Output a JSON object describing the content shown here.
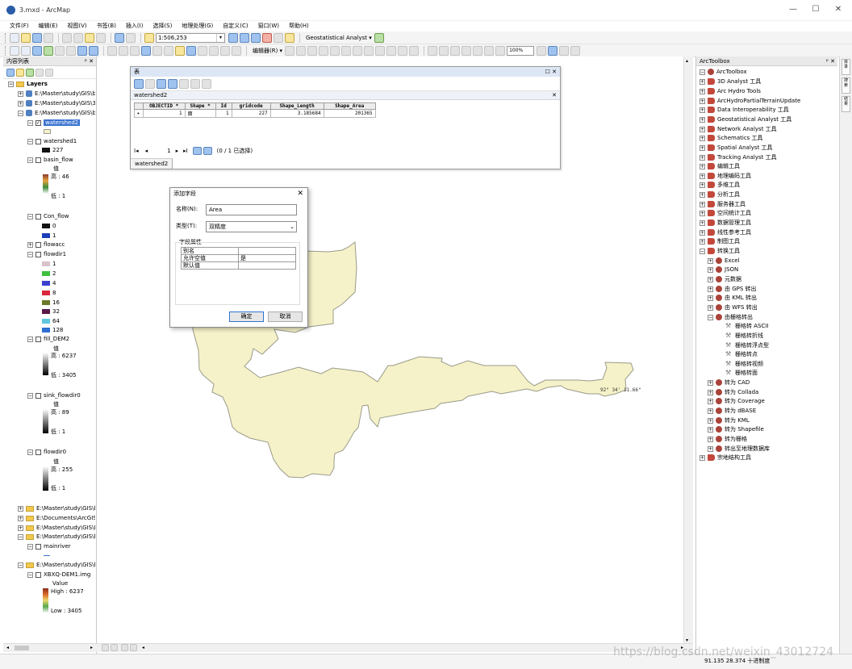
{
  "window": {
    "title": "3.mxd - ArcMap",
    "min": "—",
    "max": "☐",
    "close": "✕"
  },
  "menu": [
    "文件(F)",
    "编辑(E)",
    "视图(V)",
    "书签(B)",
    "插入(I)",
    "选择(S)",
    "地理处理(G)",
    "自定义(C)",
    "窗口(W)",
    "帮助(H)"
  ],
  "toolbar": {
    "scale": "1:506,253",
    "geostat": "Geostatistical Analyst ▾",
    "editor": "编辑器(R) ▾",
    "zoom": "100%"
  },
  "toc": {
    "title": "内容列表",
    "pin": "ᵖ ✕",
    "root": "Layers",
    "paths": [
      "E:\\Master\\study\\GIS\\b",
      "E:\\Master\\study\\GIS\\3",
      "E:\\Master\\study\\GIS\\b"
    ],
    "layers": {
      "watershed2": "watershed2",
      "watershed1": "watershed1",
      "watershed1_val": "227",
      "basin_flow": "basin_flow",
      "value_label": "值",
      "basin_high": "高 : 46",
      "basin_low": "低 : 1",
      "con_flow": "Con_flow",
      "con_0": "0",
      "con_1": "1",
      "flowacc": "flowacc",
      "flowdir1": "flowdir1",
      "flowdir_values": [
        "1",
        "2",
        "4",
        "8",
        "16",
        "32",
        "64",
        "128"
      ],
      "fill_dem2": "fill_DEM2",
      "fill_high": "高 : 6237",
      "fill_low": "低 : 3405",
      "sink_flowdir0": "sink_flowdir0",
      "sink_high": "高 : 89",
      "sink_low": "低 : 1",
      "flowdir0": "flowdir0",
      "fd0_high": "高 : 255",
      "fd0_low": "低 : 1"
    },
    "groups": [
      "E:\\Master\\study\\GIS\\b",
      "E:\\Documents\\ArcGIS\\",
      "E:\\Master\\study\\GIS\\L",
      "E:\\Master\\study\\GIS\\b"
    ],
    "mainriver": "mainriver",
    "group5": "E:\\Master\\study\\GIS\\b",
    "dem": "XBXQ-DEM1.img",
    "dem_value": "Value",
    "dem_high": "High : 6237",
    "dem_low": "Low : 3405"
  },
  "table": {
    "title": "表",
    "controls": "☐ ✕",
    "tab": "watershed2",
    "columns": [
      "OBJECTID *",
      "Shape *",
      "Id",
      "gridcode",
      "Shape_Length",
      "Shape_Area"
    ],
    "rows": [
      [
        "1",
        "面",
        "1",
        "227",
        "3.185684",
        "201365"
      ]
    ],
    "nav_page": "1",
    "nav_status": "(0 / 1 已选择)",
    "footer_tab": "watershed2"
  },
  "dialog": {
    "title": "添加字段",
    "name_label": "名称(N):",
    "name_value": "Area",
    "type_label": "类型(T):",
    "type_value": "双精度",
    "props_label": "字段属性",
    "props": [
      [
        "别名",
        ""
      ],
      [
        "允许空值",
        "是"
      ],
      [
        "默认值",
        ""
      ]
    ],
    "ok": "确定",
    "cancel": "取消"
  },
  "map": {
    "polygon_fill": "#f5f2c9",
    "polygon_stroke": "#9a9a8a",
    "coord_label": "92° 34' 11.66\""
  },
  "toolbox": {
    "title": "ArcToolbox",
    "root": "ArcToolbox",
    "items": [
      "3D Analyst 工具",
      "Arc Hydro Tools",
      "ArcHydroPartialTerrainUpdate",
      "Data Interoperability 工具",
      "Geostatistical Analyst 工具",
      "Network Analyst 工具",
      "Schematics 工具",
      "Spatial Analyst 工具",
      "Tracking Analyst 工具",
      "编辑工具",
      "地理编码工具",
      "多维工具",
      "分析工具",
      "服务器工具",
      "空间统计工具",
      "数据管理工具",
      "线性参考工具",
      "制图工具",
      "转换工具"
    ],
    "conversion_sub": [
      "Excel",
      "JSON",
      "元数据",
      "由 GPS 转出",
      "由 KML 转出",
      "由 WFS 转出",
      "由栅格转出"
    ],
    "raster_tools": [
      "栅格转 ASCII",
      "栅格转折线",
      "栅格转浮点型",
      "栅格转点",
      "栅格转视频",
      "栅格转面"
    ],
    "conversion_sub2": [
      "转为 CAD",
      "转为 Collada",
      "转为 Coverage",
      "转为 dBASE",
      "转为 KML",
      "转为 Shapefile",
      "转为栅格",
      "转出至地理数据库"
    ],
    "last": "宗地结构工具"
  },
  "right_tabs": [
    "目录",
    "搜索",
    "结果"
  ],
  "status": {
    "coords": "91.135  28.374 十进制度"
  },
  "watermark": "https://blog.csdn.net/weixin_43012724"
}
